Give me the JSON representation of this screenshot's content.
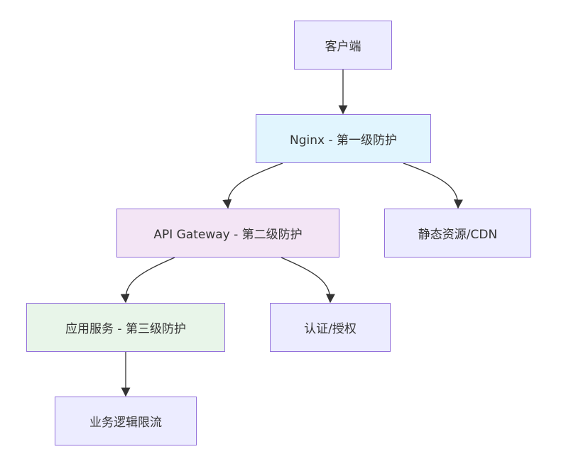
{
  "nodes": {
    "client": {
      "label": "客户端",
      "fill": "#ECECFF"
    },
    "nginx": {
      "label": "Nginx - 第一级防护",
      "fill": "#E1F5FE"
    },
    "gateway": {
      "label": "API Gateway - 第二级防护",
      "fill": "#F3E5F5"
    },
    "static": {
      "label": "静态资源/CDN",
      "fill": "#ECECFF"
    },
    "service": {
      "label": "应用服务 - 第三级防护",
      "fill": "#E8F5E9"
    },
    "auth": {
      "label": "认证/授权",
      "fill": "#ECECFF"
    },
    "business": {
      "label": "业务逻辑限流",
      "fill": "#ECECFF"
    }
  },
  "edges": [
    {
      "from": "client",
      "to": "nginx"
    },
    {
      "from": "nginx",
      "to": "gateway"
    },
    {
      "from": "nginx",
      "to": "static"
    },
    {
      "from": "gateway",
      "to": "service"
    },
    {
      "from": "gateway",
      "to": "auth"
    },
    {
      "from": "service",
      "to": "business"
    }
  ],
  "colors": {
    "border": "#9370DB",
    "edge": "#333333",
    "text": "#333333"
  }
}
